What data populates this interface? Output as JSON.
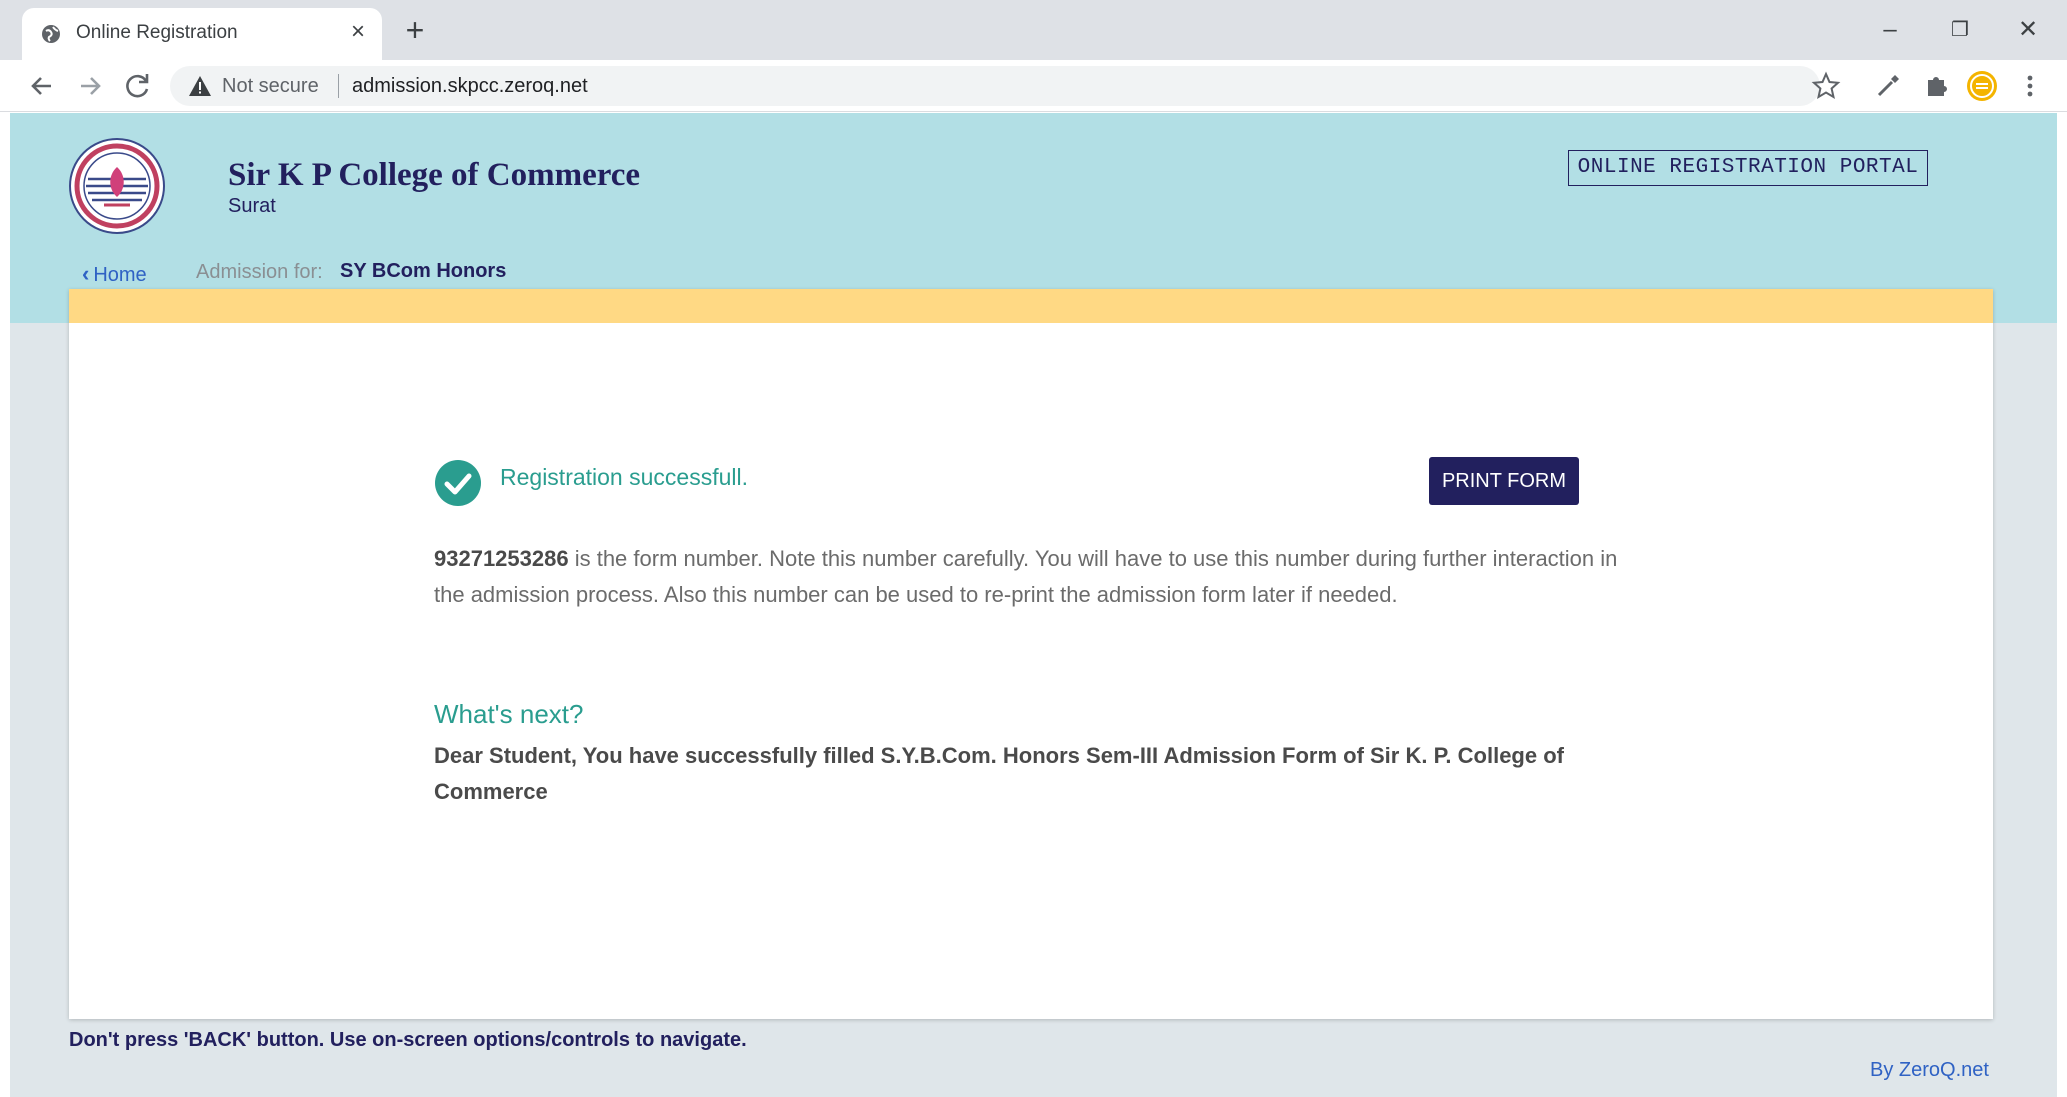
{
  "browser": {
    "tab_title": "Online Registration",
    "tab_close": "×",
    "new_tab": "+",
    "window_controls": {
      "minimize": "–",
      "restore": "❐",
      "close": "✕"
    },
    "security_label": "Not secure",
    "url": "admission.skpcc.zeroq.net",
    "icons": [
      "back-icon",
      "forward-icon",
      "reload-icon",
      "star-icon",
      "eyedropper-icon",
      "extensions-icon",
      "profile-icon",
      "menu-icon"
    ]
  },
  "header": {
    "college_name": "Sir K P College of Commerce",
    "city": "Surat",
    "portal_label": "ONLINE REGISTRATION PORTAL",
    "home_link": "Home",
    "admission_label": "Admission for:",
    "admission_value": "SY BCom Honors"
  },
  "main": {
    "success_message": "Registration successfull.",
    "print_button": "PRINT FORM",
    "form_number": "93271253286",
    "form_info": " is the form number. Note this number carefully. You will have to use this number during further interaction in the admission process. Also this number can be used to re-print the admission form later if needed.",
    "next_heading": "What's next?",
    "next_text": "Dear Student, You have successfully filled S.Y.B.Com. Honors Sem-III Admission Form of Sir K. P. College of Commerce"
  },
  "footer": {
    "warning": "Don't press 'BACK' button. Use on-screen options/controls to navigate.",
    "by": "By ZeroQ.net"
  },
  "colors": {
    "header_bg": "#b2dfe5",
    "page_bg": "#dfe6ea",
    "strip": "#ffd984",
    "navy": "#22205e",
    "teal": "#2a9d8f",
    "link": "#2f62c4"
  }
}
